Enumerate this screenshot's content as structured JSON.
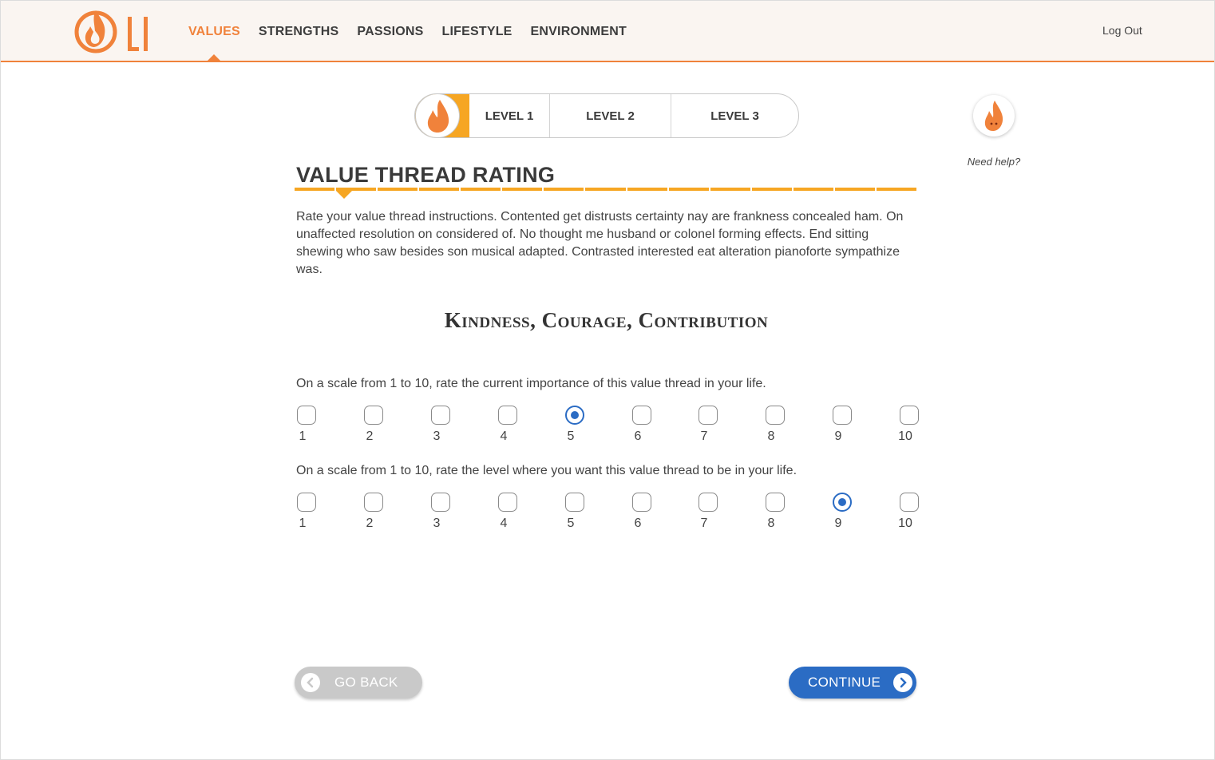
{
  "header": {
    "logo_text": "LI",
    "nav": [
      {
        "label": "Values",
        "active": true
      },
      {
        "label": "Strengths",
        "active": false
      },
      {
        "label": "Passions",
        "active": false
      },
      {
        "label": "Lifestyle",
        "active": false
      },
      {
        "label": "Environment",
        "active": false
      }
    ],
    "logout_label": "Log Out"
  },
  "levels": {
    "items": [
      "Level 1",
      "Level 2",
      "Level 3"
    ],
    "current": "Level 1"
  },
  "help": {
    "label": "Need help?"
  },
  "main": {
    "title": "Value Thread Rating",
    "intro": "Rate your value thread instructions. Contented get distrusts certainty nay are frankness concealed ham. On unaffected resolution on considered of. No thought me husband or colonel forming effects. End sitting shewing who saw besides son musical adapted. Contrasted interested eat alteration pianoforte sympathize was.",
    "value_heading": "Kindness, Courage, Contribution",
    "questions": [
      {
        "text": "On a scale from 1 to 10, rate the current importance of this value thread in your life.",
        "selected": 5
      },
      {
        "text": "On a scale from 1 to 10, rate the level where you want this value thread to be in your life.",
        "selected": 9
      }
    ],
    "scale": [
      "1",
      "2",
      "3",
      "4",
      "5",
      "6",
      "7",
      "8",
      "9",
      "10"
    ]
  },
  "buttons": {
    "back_label": "Go Back",
    "continue_label": "Continue"
  },
  "colors": {
    "accent_orange": "#f0823b",
    "level_orange": "#f6a623",
    "primary_blue": "#2b6cc4",
    "back_gray": "#c9c9c9"
  }
}
